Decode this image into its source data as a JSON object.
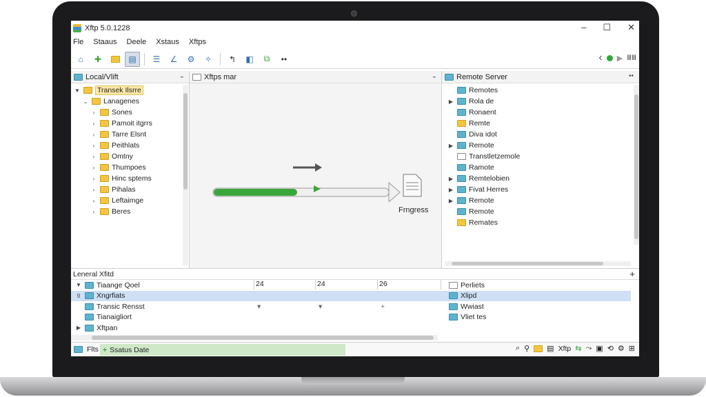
{
  "window": {
    "title": "Xftp 5.0.1228"
  },
  "window_controls": {
    "minimize": "–",
    "maximize": "☐",
    "close": "✕"
  },
  "menu": [
    "Fle",
    "Staaus",
    "Deele",
    "Xstaus",
    "Xftps"
  ],
  "toolbar_right": {
    "back": "‹",
    "forward": "›",
    "grid": "ⅢⅢ"
  },
  "left_panel": {
    "header": "Local/Vlift",
    "tree": [
      {
        "label": "Transek Ilsrre",
        "arrow": "▼",
        "indent": 0,
        "selected": true
      },
      {
        "label": "Lanagenes",
        "arrow": "⌄",
        "indent": 1
      },
      {
        "label": "Sones",
        "arrow": "›",
        "indent": 2
      },
      {
        "label": "Pamoit itgrrs",
        "arrow": "›",
        "indent": 2
      },
      {
        "label": "Tarre Elsnt",
        "arrow": "›",
        "indent": 2
      },
      {
        "label": "Peithlats",
        "arrow": "›",
        "indent": 2
      },
      {
        "label": "Omtny",
        "arrow": "›",
        "indent": 2
      },
      {
        "label": "Thumpoes",
        "arrow": "›",
        "indent": 2
      },
      {
        "label": "Hinc sptems",
        "arrow": "›",
        "indent": 2
      },
      {
        "label": "Pihalas",
        "arrow": "›",
        "indent": 2
      },
      {
        "label": "Leftaimge",
        "arrow": "›",
        "indent": 2
      },
      {
        "label": "Beres",
        "arrow": "›",
        "indent": 2
      }
    ]
  },
  "middle_panel": {
    "header": "Xftps mar",
    "progress_label": "Frngress",
    "progress": 0.48
  },
  "right_panel": {
    "header": "Remote Server",
    "tree": [
      {
        "label": "Remotes",
        "arrow": ""
      },
      {
        "label": "Rola de",
        "arrow": "▶"
      },
      {
        "label": "Ronaent",
        "arrow": ""
      },
      {
        "label": "Remte",
        "arrow": ""
      },
      {
        "label": "Diva idot",
        "arrow": ""
      },
      {
        "label": "Remote",
        "arrow": "▶"
      },
      {
        "label": "Transtletzemole",
        "arrow": ""
      },
      {
        "label": "Ramote",
        "arrow": ""
      },
      {
        "label": "Remtelobien",
        "arrow": "▶"
      },
      {
        "label": "Fivat Herres",
        "arrow": "▶"
      },
      {
        "label": "Remote",
        "arrow": "▶"
      },
      {
        "label": "Remote",
        "arrow": ""
      },
      {
        "label": "Remates",
        "arrow": ""
      }
    ]
  },
  "transfer_list": {
    "header": "Leneral Xfitd",
    "add": "+",
    "columns": [
      "24",
      "24",
      "26"
    ],
    "rows": [
      {
        "name": "Tiaange Qoel",
        "arrow": "▼",
        "c1": "",
        "c2": "",
        "c3": "",
        "remote": "Perliets",
        "selected": false
      },
      {
        "name": "Xngrfiats",
        "arrow": "9",
        "c1": "",
        "c2": "",
        "c3": "",
        "remote": "Xlipd",
        "selected": true
      },
      {
        "name": "Transic Rensst",
        "arrow": "",
        "c1": "▾",
        "c2": "▾",
        "c3": "+",
        "remote": "Wwiast",
        "selected": false
      },
      {
        "name": "Tianaigliort",
        "arrow": "",
        "c1": "",
        "c2": "",
        "c3": "",
        "remote": "Vliet tes",
        "selected": false
      },
      {
        "name": "Xftpan",
        "arrow": "▶",
        "c1": "",
        "c2": "",
        "c3": "",
        "remote": "",
        "selected": false
      }
    ]
  },
  "statusbar": {
    "left": "Flts",
    "status": "Ssatus Date",
    "right_label": "Xftp"
  },
  "colors": {
    "accent": "#3b8fd9",
    "progress": "#3aa63a",
    "selection": "#cfe0f5",
    "status_bg": "#cfe8c8"
  }
}
